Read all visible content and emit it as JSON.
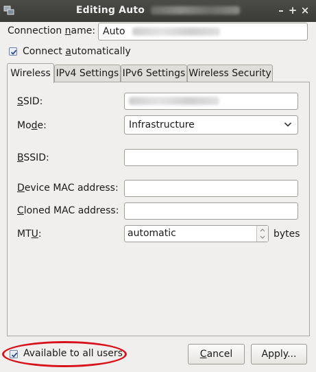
{
  "window": {
    "title_prefix": "Editing Auto",
    "title_suffix_hidden": "",
    "controls": {
      "minimize": "–",
      "maximize": "+",
      "close": "×"
    }
  },
  "connection": {
    "name_label_pre": "Connection ",
    "name_label_u": "n",
    "name_label_post": "ame:",
    "name_value": "Auto",
    "connect_auto_pre": "Connect ",
    "connect_auto_u": "a",
    "connect_auto_post": "utomatically",
    "connect_auto_checked": true
  },
  "tabs": [
    {
      "label": "Wireless",
      "active": true
    },
    {
      "label": "IPv4 Settings",
      "active": false
    },
    {
      "label": "IPv6 Settings",
      "active": false
    },
    {
      "label": "Wireless Security",
      "active": false
    }
  ],
  "wireless": {
    "ssid_label_u": "S",
    "ssid_label_post": "SID:",
    "ssid_value": "",
    "mode_label_pre": "Mo",
    "mode_label_u": "d",
    "mode_label_post": "e:",
    "mode_value": "Infrastructure",
    "bssid_label_u": "B",
    "bssid_label_post": "SSID:",
    "bssid_value": "",
    "device_mac_label_u": "D",
    "device_mac_label_post": "evice MAC address:",
    "device_mac_value": "",
    "cloned_mac_label_u": "C",
    "cloned_mac_label_post": "loned MAC address:",
    "cloned_mac_value": "",
    "mtu_label_pre": "MT",
    "mtu_label_u": "U",
    "mtu_label_post": ":",
    "mtu_value": "automatic",
    "mtu_unit": "bytes"
  },
  "footer": {
    "available_all_users": "Available to all users",
    "available_checked": true,
    "cancel_u": "C",
    "cancel_post": "ancel",
    "apply": "Apply..."
  },
  "colors": {
    "titlebar": "#3c3b37",
    "highlight_ring": "#d8121a",
    "background": "#f0efee"
  }
}
